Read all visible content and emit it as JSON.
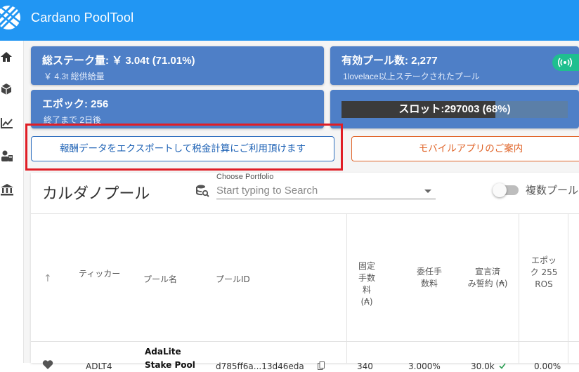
{
  "app": {
    "title": "Cardano PoolTool"
  },
  "stats": {
    "total_stake": {
      "main": "総ステーク量: ￥ 3.04t (71.01%)",
      "sub": "￥ 4.3t 総供給量"
    },
    "active_pools": {
      "main": "有効プール数: 2,277",
      "sub": "1lovelace以上ステークされたプール"
    },
    "epoch": {
      "main": "エポック: 256",
      "sub": "終了まで 2日後"
    },
    "slot": {
      "label": "スロット:297003 (68%)",
      "progress": 0.68
    }
  },
  "buttons": {
    "export": "報酬データをエクスポートして税金計算にご利用頂けます",
    "mobile": "モバイルアプリのご案内"
  },
  "panel": {
    "title": "カルダノプール",
    "portfolio_label": "Choose Portfolio",
    "portfolio_placeholder": "Start typing to Search",
    "multi_pool_label": "複数プール"
  },
  "table": {
    "headers": {
      "ticker": "ティッカー",
      "pool_name": "プール名",
      "pool_id": "プールID",
      "fixed_fee": "固定\n手数\n料\n(₳)",
      "margin": "委任手\n数料",
      "pledge": "宣言済\nみ誓約 (₳)",
      "epoch_ros": "エポッ\nク 255\nROS"
    },
    "rows": [
      {
        "ticker": "ADLT4",
        "pool_name": "AdaLite\nStake Pool",
        "pool_id": "d785ff6a...13d46eda",
        "fixed_fee": "340",
        "margin": "3.000%",
        "pledge": "30.0k",
        "ros": "0.00%"
      }
    ]
  },
  "colors": {
    "appbar": "#2196f3",
    "card": "#4e7fc7",
    "export_accent": "#1e62b5",
    "mobile_accent": "#e0652a",
    "highlight": "#e01e26",
    "live": "#1fbf8f"
  }
}
